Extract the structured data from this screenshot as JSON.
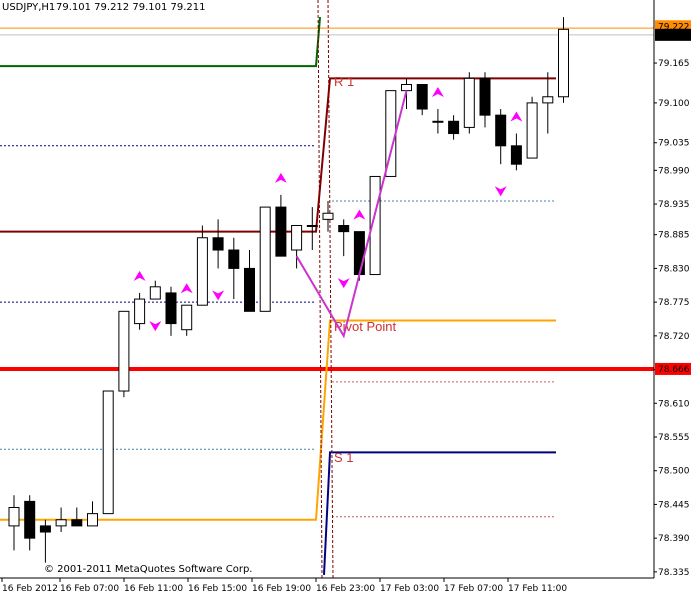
{
  "header": {
    "symbol": "USDJPY,H1",
    "ohlc": "79.101 79.212 79.101 79.211"
  },
  "copyright": "© 2001-2011 MetaQuotes Software Corp.",
  "colors": {
    "background": "#ffffff",
    "axis": "#000000",
    "bull_candle": "#ffffff",
    "bear_candle": "#000000",
    "candle_outline": "#000000",
    "pivot": "#ffa500",
    "r1": "#800000",
    "s1": "#000080",
    "green_line": "#006400",
    "main_level": "#ff0000",
    "arrows": "#ff00ff",
    "zigzag": "#cc33cc",
    "ask_line": "#ff8c00",
    "price_box_bg": "#000000",
    "price_box_fg": "#ffffff"
  },
  "chart_data": {
    "type": "candlestick",
    "y_axis": {
      "ticks": [
        "79.165",
        "79.100",
        "79.035",
        "78.990",
        "78.935",
        "78.885",
        "78.830",
        "78.775",
        "78.720",
        "78.665",
        "78.610",
        "78.555",
        "78.500",
        "78.445",
        "78.390",
        "78.335"
      ],
      "range": [
        78.325,
        79.245
      ],
      "ask_marker": "79.222",
      "current_marker": "79.211",
      "level_marker": "78.666"
    },
    "x_axis": {
      "tick_labels": [
        "16 Feb 2012",
        "16 Feb 07:00",
        "16 Feb 11:00",
        "16 Feb 15:00",
        "16 Feb 19:00",
        "16 Feb 23:00",
        "17 Feb 03:00",
        "17 Feb 07:00",
        "17 Feb 11:00"
      ]
    },
    "candles": [
      {
        "o": 78.41,
        "h": 78.46,
        "l": 78.37,
        "c": 78.44
      },
      {
        "o": 78.45,
        "h": 78.46,
        "l": 78.37,
        "c": 78.39
      },
      {
        "o": 78.41,
        "h": 78.42,
        "l": 78.35,
        "c": 78.4
      },
      {
        "o": 78.41,
        "h": 78.44,
        "l": 78.4,
        "c": 78.42
      },
      {
        "o": 78.42,
        "h": 78.44,
        "l": 78.41,
        "c": 78.41
      },
      {
        "o": 78.41,
        "h": 78.45,
        "l": 78.41,
        "c": 78.43
      },
      {
        "o": 78.43,
        "h": 78.63,
        "l": 78.43,
        "c": 78.63
      },
      {
        "o": 78.63,
        "h": 78.76,
        "l": 78.62,
        "c": 78.76
      },
      {
        "o": 78.74,
        "h": 78.79,
        "l": 78.73,
        "c": 78.78
      },
      {
        "o": 78.78,
        "h": 78.81,
        "l": 78.78,
        "c": 78.8
      },
      {
        "o": 78.79,
        "h": 78.8,
        "l": 78.72,
        "c": 78.74
      },
      {
        "o": 78.73,
        "h": 78.77,
        "l": 78.72,
        "c": 78.77
      },
      {
        "o": 78.77,
        "h": 78.9,
        "l": 78.77,
        "c": 78.88
      },
      {
        "o": 78.88,
        "h": 78.91,
        "l": 78.83,
        "c": 78.86
      },
      {
        "o": 78.86,
        "h": 78.88,
        "l": 78.78,
        "c": 78.83
      },
      {
        "o": 78.83,
        "h": 78.86,
        "l": 78.76,
        "c": 78.76
      },
      {
        "o": 78.76,
        "h": 78.93,
        "l": 78.76,
        "c": 78.93
      },
      {
        "o": 78.93,
        "h": 78.95,
        "l": 78.85,
        "c": 78.85
      },
      {
        "o": 78.86,
        "h": 78.9,
        "l": 78.83,
        "c": 78.9
      },
      {
        "o": 78.9,
        "h": 78.93,
        "l": 78.86,
        "c": 78.9
      },
      {
        "o": 78.91,
        "h": 78.94,
        "l": 78.89,
        "c": 78.92
      },
      {
        "o": 78.9,
        "h": 78.91,
        "l": 78.85,
        "c": 78.89
      },
      {
        "o": 78.89,
        "h": 78.89,
        "l": 78.81,
        "c": 78.82
      },
      {
        "o": 78.82,
        "h": 78.98,
        "l": 78.82,
        "c": 78.98
      },
      {
        "o": 78.98,
        "h": 79.12,
        "l": 78.98,
        "c": 79.12
      },
      {
        "o": 79.12,
        "h": 79.14,
        "l": 79.09,
        "c": 79.13
      },
      {
        "o": 79.13,
        "h": 79.13,
        "l": 79.08,
        "c": 79.09
      },
      {
        "o": 79.07,
        "h": 79.09,
        "l": 79.05,
        "c": 79.07
      },
      {
        "o": 79.07,
        "h": 79.08,
        "l": 79.04,
        "c": 79.05
      },
      {
        "o": 79.06,
        "h": 79.15,
        "l": 79.05,
        "c": 79.14
      },
      {
        "o": 79.14,
        "h": 79.15,
        "l": 79.06,
        "c": 79.08
      },
      {
        "o": 79.08,
        "h": 79.09,
        "l": 79.0,
        "c": 79.03
      },
      {
        "o": 79.03,
        "h": 79.05,
        "l": 78.99,
        "c": 79.0
      },
      {
        "o": 79.01,
        "h": 79.11,
        "l": 79.01,
        "c": 79.1
      },
      {
        "o": 79.1,
        "h": 79.15,
        "l": 79.05,
        "c": 79.11
      },
      {
        "o": 79.11,
        "h": 79.24,
        "l": 79.1,
        "c": 79.22
      }
    ],
    "pivot_levels": [
      {
        "name": "R 1",
        "value": 79.14
      },
      {
        "name": "Pivot Point",
        "value": 78.745
      },
      {
        "name": "S 1",
        "value": 78.53
      }
    ],
    "previous_day_levels": {
      "r1": 78.89,
      "pivot": 78.42,
      "resistance": 79.14
    },
    "horizontal_levels": [
      {
        "value": 78.666,
        "style": "solid-thick",
        "color": "#ff0000"
      },
      {
        "value": 79.222,
        "style": "solid",
        "color": "#ff8c00"
      },
      {
        "value": 79.211,
        "style": "solid",
        "color": "#c0c0c0"
      }
    ],
    "zigzag": [
      {
        "i": 18,
        "v": 78.85
      },
      {
        "i": 21,
        "v": 78.72
      },
      {
        "i": 25,
        "v": 79.12
      }
    ],
    "arrows_up": [
      8,
      11,
      17,
      22,
      27,
      32
    ],
    "arrows_down": [
      9,
      13,
      21,
      31
    ]
  }
}
